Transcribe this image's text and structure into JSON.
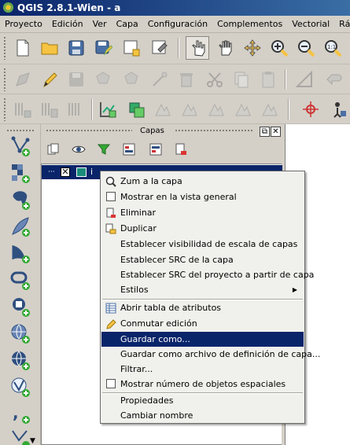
{
  "window": {
    "title": "QGIS 2.8.1-Wien - a"
  },
  "menubar": {
    "items": [
      "Proyecto",
      "Edición",
      "Ver",
      "Capa",
      "Configuración",
      "Complementos",
      "Vectorial",
      "Ráster"
    ]
  },
  "layers_panel": {
    "title": "Capas",
    "layer_name": "i"
  },
  "context_menu": {
    "items": [
      {
        "label": "Zum a la capa",
        "icon": "zoom-icon"
      },
      {
        "label": "Mostrar en la vista general",
        "icon": "checkbox"
      },
      {
        "label": "Eliminar",
        "icon": "remove-layer-icon"
      },
      {
        "label": "Duplicar",
        "icon": "duplicate-icon"
      },
      {
        "label": "Establecer visibilidad de escala de capas"
      },
      {
        "label": "Establecer SRC de la capa"
      },
      {
        "label": "Establecer SRC del proyecto a partir de capa"
      },
      {
        "label": "Estilos",
        "submenu": true
      },
      {
        "label": "Abrir tabla de atributos",
        "icon": "table-icon"
      },
      {
        "label": "Conmutar edición",
        "icon": "pencil-icon"
      },
      {
        "label": "Guardar como...",
        "highlighted": true
      },
      {
        "label": "Guardar como archivo de definición de capa..."
      },
      {
        "label": "Filtrar..."
      },
      {
        "label": "Mostrar número de objetos espaciales",
        "icon": "checkbox"
      },
      {
        "label": "Propiedades"
      },
      {
        "label": "Cambiar nombre"
      }
    ]
  },
  "colors": {
    "highlight": "#0a246a",
    "layer_swatch": "#1a8c7c",
    "chrome": "#d4d0c8"
  }
}
